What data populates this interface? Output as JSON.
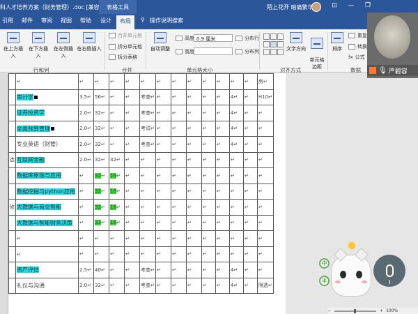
{
  "titlebar": {
    "doc_title": "科人才培养方案（财务管理）.doc [兼容模...",
    "context_tab": "表格工具",
    "user": "陌上花开 暗痛繁华",
    "win_min": "—",
    "win_restore": "❐",
    "win_close": "✕",
    "win_ribbon": "⊡"
  },
  "tabs": [
    "引用",
    "邮件",
    "审阅",
    "视图",
    "帮助",
    "设计",
    "布局"
  ],
  "active_tab": "布局",
  "tell_me": "操作说明搜索",
  "ribbon": {
    "insert_above": "在上方插入",
    "insert_below": "在下方插入",
    "insert_left": "在左侧插入",
    "insert_right": "在右侧插入",
    "group_rows": "行和列",
    "merge_cells": "合并单元格",
    "split_cells": "拆分单元格",
    "split_table": "拆分表格",
    "group_merge": "合并",
    "autofit": "自动调整",
    "height_label": "高度:",
    "height_value": "0.9 厘米",
    "width_label": "宽度:",
    "width_value": "",
    "dist_rows": "分布行",
    "dist_cols": "分布列",
    "group_size": "单元格大小",
    "text_dir": "文字方向",
    "cell_margin": "单元格\n边距",
    "group_align": "对齐方式",
    "sort": "排序",
    "repeat_header": "重复标",
    "convert": "转换成",
    "formula": "公式",
    "group_data": "数据"
  },
  "video": {
    "name": "严碧容"
  },
  "table": {
    "category_1": "选",
    "category_2": "修",
    "arrow": "↵",
    "side_top": "房",
    "rows": [
      {
        "course": "",
        "highlight": "cyan",
        "square": false,
        "credit": "",
        "hours": "",
        "h3": "",
        "exam": "",
        "sem": "",
        "last": ""
      },
      {
        "course": "审计学",
        "highlight": "cyan",
        "square": true,
        "credit": "3.5",
        "hours": "56",
        "h3": "",
        "exam": "考查",
        "sem": "4",
        "last": "H10"
      },
      {
        "course": "证券投资学",
        "highlight": "cyan",
        "square": false,
        "credit": "2.0",
        "hours": "32",
        "h3": "",
        "exam": "考查",
        "sem": "4",
        "last": ""
      },
      {
        "course": "全面预算管理",
        "highlight": "cyan",
        "square": true,
        "credit": "2.0",
        "hours": "32",
        "h3": "",
        "exam": "考试",
        "sem": "4",
        "last": ""
      },
      {
        "course": "专业英语（财管）",
        "highlight": "",
        "square": false,
        "credit": "2.0",
        "hours": "32",
        "h3": "",
        "exam": "考查",
        "sem": "4",
        "last": ""
      },
      {
        "course": "互联网金融",
        "highlight": "cyan",
        "square": false,
        "credit": "2.0",
        "hours": "32",
        "h3": "32",
        "exam": "",
        "sem": "",
        "last": ""
      },
      {
        "course": "数据库原理与应用",
        "highlight": "cyan",
        "square": false,
        "credit": "",
        "hours": "32",
        "h3": "16",
        "exam": "",
        "sem": "",
        "last": "",
        "green": true
      },
      {
        "course": "数据挖掘与python应用",
        "highlight": "cyan",
        "square": false,
        "credit": "",
        "hours": "32",
        "h3": "16",
        "exam": "",
        "sem": "",
        "last": "",
        "green": true
      },
      {
        "course": "大数据与商业智能",
        "highlight": "cyan",
        "square": false,
        "credit": "",
        "hours": "32",
        "h3": "16",
        "exam": "",
        "sem": "",
        "last": "",
        "green": true
      },
      {
        "course": "大数据与智能财务决策",
        "highlight": "cyan",
        "square": false,
        "credit": "",
        "hours": "32",
        "h3": "16",
        "exam": "",
        "sem": "",
        "last": "",
        "green": true
      },
      {
        "course": "",
        "highlight": "",
        "square": false,
        "credit": "",
        "hours": "",
        "h3": "",
        "exam": "",
        "sem": "",
        "last": ""
      },
      {
        "course": "",
        "highlight": "",
        "square": false,
        "credit": "",
        "hours": "",
        "h3": "",
        "exam": "",
        "sem": "",
        "last": ""
      },
      {
        "course": "资产评估",
        "highlight": "cyan",
        "square": false,
        "credit": "2.5",
        "hours": "40",
        "h3": "",
        "exam": "考查",
        "sem": "4",
        "last": ""
      },
      {
        "course": "礼仪与沟通",
        "highlight": "",
        "square": false,
        "credit": "2.0",
        "hours": "32",
        "h3": "",
        "exam": "考查",
        "sem": "4",
        "last": "限选"
      }
    ]
  },
  "sticker": {
    "tag1": "中",
    "tag2": "半"
  },
  "status": {
    "zoom": "100%"
  }
}
